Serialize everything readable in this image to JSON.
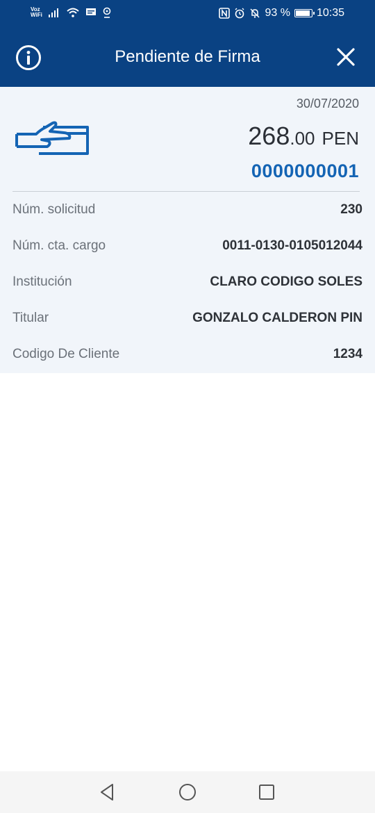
{
  "status_bar": {
    "voz_line1": "Voz",
    "voz_line2": "WiFi",
    "battery_text": "93 %",
    "battery_level": 0.93,
    "time": "10:35",
    "icons": [
      "signal-icon",
      "wifi-icon",
      "message-icon",
      "location-icon",
      "nfc-icon",
      "alarm-icon",
      "mute-icon",
      "battery-icon"
    ]
  },
  "header": {
    "title": "Pendiente de Firma",
    "left_icon": "info-icon",
    "right_icon": "close-icon",
    "background": "#0a4283"
  },
  "summary": {
    "date": "30/07/2020",
    "icon": "payment-hand-card-icon",
    "amount_int": "268",
    "amount_dec": ".00",
    "currency": "PEN",
    "reference": "0000000001",
    "reference_color": "#1464b4"
  },
  "details": [
    {
      "label": "Núm. solicitud",
      "value": "230"
    },
    {
      "label": "Núm. cta. cargo",
      "value": "0011-0130-0105012044"
    },
    {
      "label": "Institución",
      "value": "CLARO CODIGO SOLES"
    },
    {
      "label": "Titular",
      "value": "GONZALO CALDERON PIN"
    },
    {
      "label": "Codigo De Cliente",
      "value": "1234"
    }
  ],
  "nav": {
    "icons": [
      "back-icon",
      "home-icon",
      "recents-icon"
    ]
  }
}
